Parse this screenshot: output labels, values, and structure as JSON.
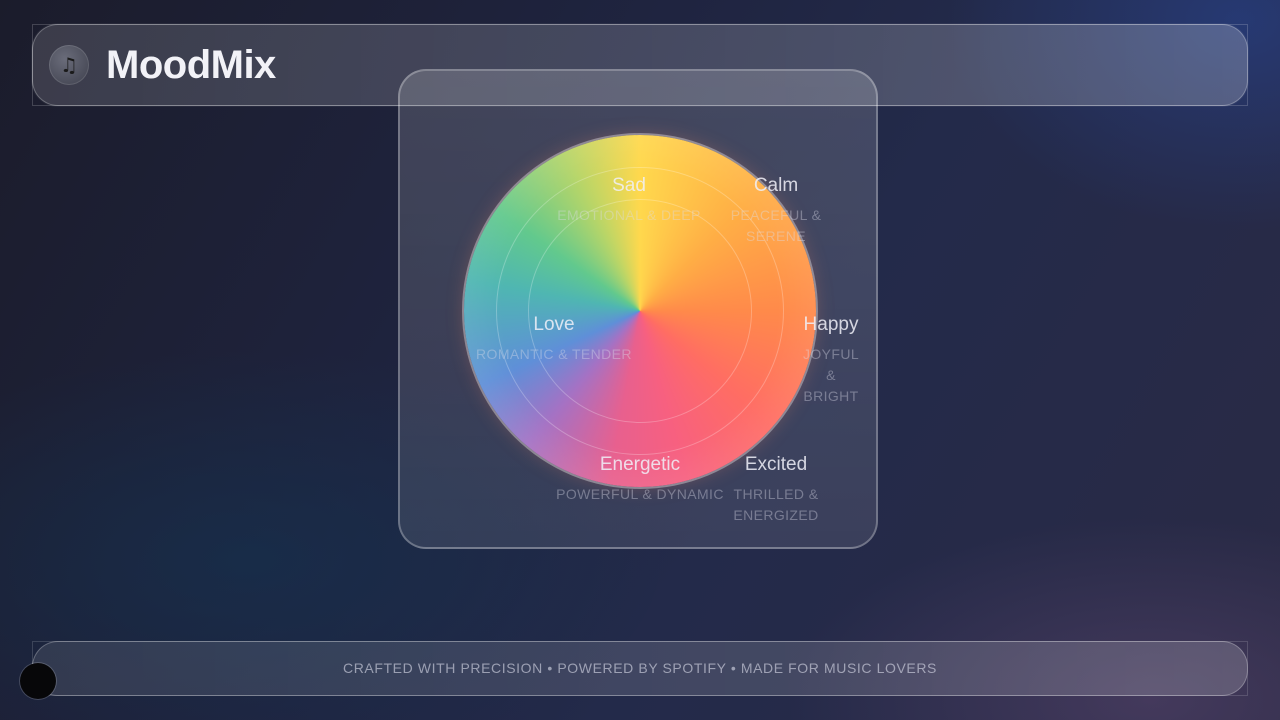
{
  "app": {
    "title": "MoodMix",
    "logo_icon": "music-note-icon",
    "logo_glyph": "♫"
  },
  "wheel": {
    "moods": [
      {
        "id": "sad",
        "name": "Sad",
        "description": "EMOTIONAL & DEEP"
      },
      {
        "id": "calm",
        "name": "Calm",
        "description": "PEACEFUL & SERENE"
      },
      {
        "id": "love",
        "name": "Love",
        "description": "ROMANTIC & TENDER"
      },
      {
        "id": "happy",
        "name": "Happy",
        "description": "JOYFUL & BRIGHT"
      },
      {
        "id": "energetic",
        "name": "Energetic",
        "description": "POWERFUL & DYNAMIC"
      },
      {
        "id": "excited",
        "name": "Excited",
        "description": "THRILLED & ENERGIZED"
      }
    ],
    "gradient_colors": [
      "#ffd84d",
      "#ff8a4a",
      "#f76080",
      "#5f8fd8",
      "#4fb6b2",
      "#62c98d"
    ]
  },
  "footer": {
    "text": "CRAFTED WITH PRECISION • POWERED BY SPOTIFY • MADE FOR MUSIC LOVERS"
  }
}
